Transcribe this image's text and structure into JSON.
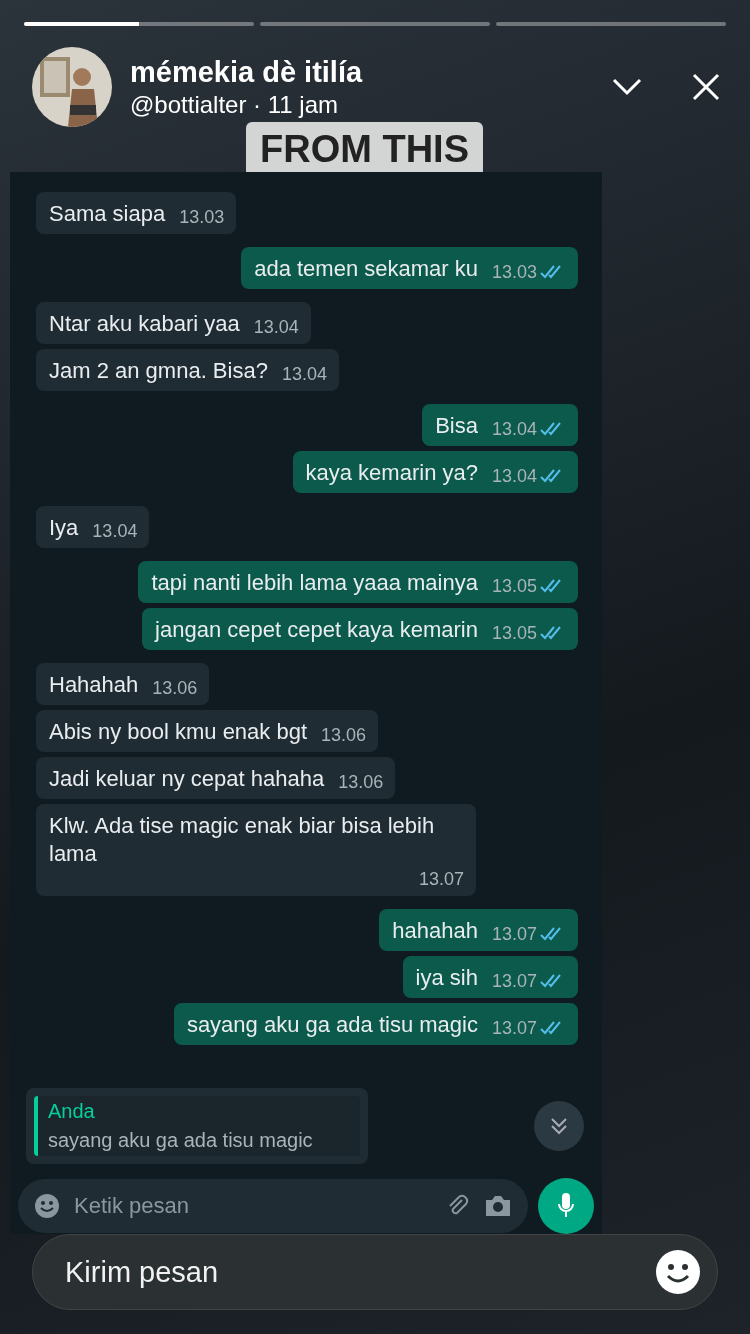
{
  "story": {
    "progress": {
      "level": 0.5
    },
    "name": "mémekia dè itilía",
    "handle": "@bottialter · 11 jam",
    "caption": "FROM THIS"
  },
  "chat": {
    "messages": [
      {
        "kind": "in",
        "text": "Sama siapa",
        "time": "13.03"
      },
      {
        "kind": "out",
        "text": "ada temen sekamar ku",
        "time": "13.03",
        "read": true
      },
      {
        "kind": "in",
        "text": "Ntar aku kabari yaa",
        "time": "13.04"
      },
      {
        "kind": "in",
        "text": "Jam 2 an gmna. Bisa?",
        "time": "13.04"
      },
      {
        "kind": "out",
        "text": "Bisa",
        "time": "13.04",
        "read": true
      },
      {
        "kind": "out",
        "text": "kaya kemarin ya?",
        "time": "13.04",
        "read": true
      },
      {
        "kind": "in",
        "text": "Iya",
        "time": "13.04"
      },
      {
        "kind": "out",
        "text": "tapi nanti lebih lama yaaa mainya",
        "time": "13.05",
        "read": true
      },
      {
        "kind": "out",
        "text": "jangan cepet cepet kaya kemarin",
        "time": "13.05",
        "read": true
      },
      {
        "kind": "in",
        "text": "Hahahah",
        "time": "13.06"
      },
      {
        "kind": "in",
        "text": "Abis ny bool kmu enak bgt",
        "time": "13.06"
      },
      {
        "kind": "in",
        "text": "Jadi keluar ny cepat hahaha",
        "time": "13.06"
      },
      {
        "kind": "in",
        "text": "Klw. Ada tise magic enak biar bisa lebih lama",
        "time": "13.07"
      },
      {
        "kind": "out",
        "text": "hahahah",
        "time": "13.07",
        "read": true
      },
      {
        "kind": "out",
        "text": "iya sih",
        "time": "13.07",
        "read": true
      },
      {
        "kind": "out",
        "text": "sayang aku ga ada tisu magic",
        "time": "13.07",
        "read": true
      }
    ],
    "reply": {
      "author": "Anda",
      "text": "sayang aku ga ada tisu magic"
    },
    "input": {
      "placeholder": "Ketik pesan"
    }
  },
  "message_bar": {
    "placeholder": "Kirim pesan"
  }
}
